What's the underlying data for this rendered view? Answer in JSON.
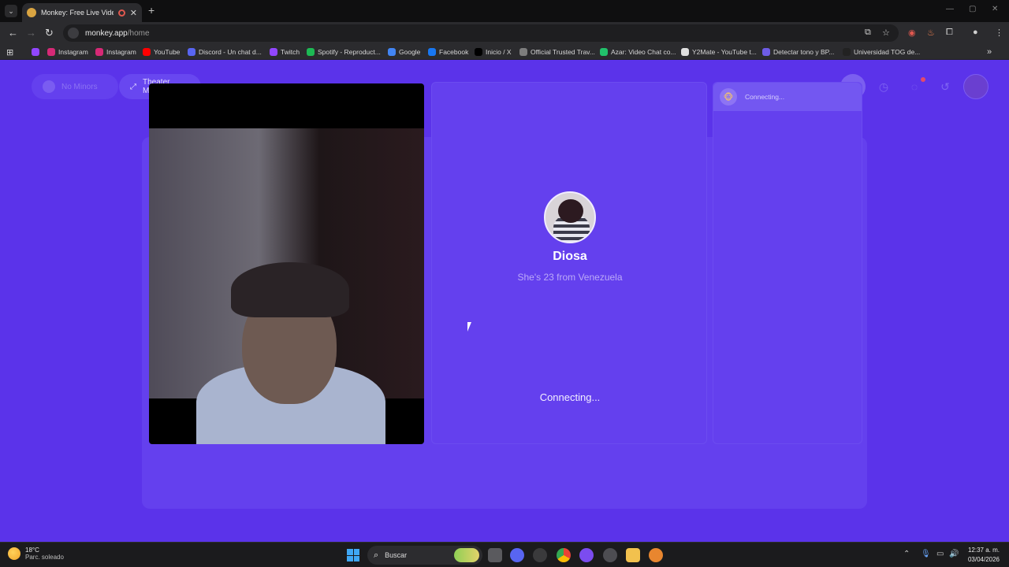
{
  "browser": {
    "tab_title": "Monkey: Free Live Video Ch",
    "url_host": "monkey.app",
    "url_path": "/home",
    "bookmarks": [
      {
        "label": "Instagram",
        "color": "#d62976"
      },
      {
        "label": "Instagram",
        "color": "#d62976"
      },
      {
        "label": "YouTube",
        "color": "#ff0000"
      },
      {
        "label": "Discord - Un chat d...",
        "color": "#5865f2"
      },
      {
        "label": "Twitch",
        "color": "#9146ff"
      },
      {
        "label": "Spotify - Reproduct...",
        "color": "#1db954"
      },
      {
        "label": "Google",
        "color": "#4285f4"
      },
      {
        "label": "Facebook",
        "color": "#1877f2"
      },
      {
        "label": "Inicio / X",
        "color": "#000000"
      },
      {
        "label": "Official Trusted Trav...",
        "color": "#7d7d7d"
      },
      {
        "label": "Azar: Video Chat co...",
        "color": "#21c16b"
      },
      {
        "label": "Y2Mate - YouTube t...",
        "color": "#e0e0e0"
      },
      {
        "label": "Detectar tono y BP...",
        "color": "#6e5ce6"
      },
      {
        "label": "Universidad TOG de...",
        "color": "#222222"
      }
    ]
  },
  "header": {
    "no_minors_label": "No Minors",
    "theater_mode_label": "Theater Mode"
  },
  "match": {
    "name": "Diosa",
    "subtitle": "She's 23 from Venezuela",
    "status": "Connecting..."
  },
  "chat": {
    "status": "Connecting..."
  },
  "taskbar": {
    "temperature": "18°C",
    "weather_desc": "Parc. soleado",
    "search_placeholder": "Buscar",
    "time": "12:37 a. m.",
    "date": "03/04/2026"
  },
  "colors": {
    "page_bg": "#5b33ea",
    "panel_bg": "#6440ee",
    "accent": "#7357f1"
  }
}
